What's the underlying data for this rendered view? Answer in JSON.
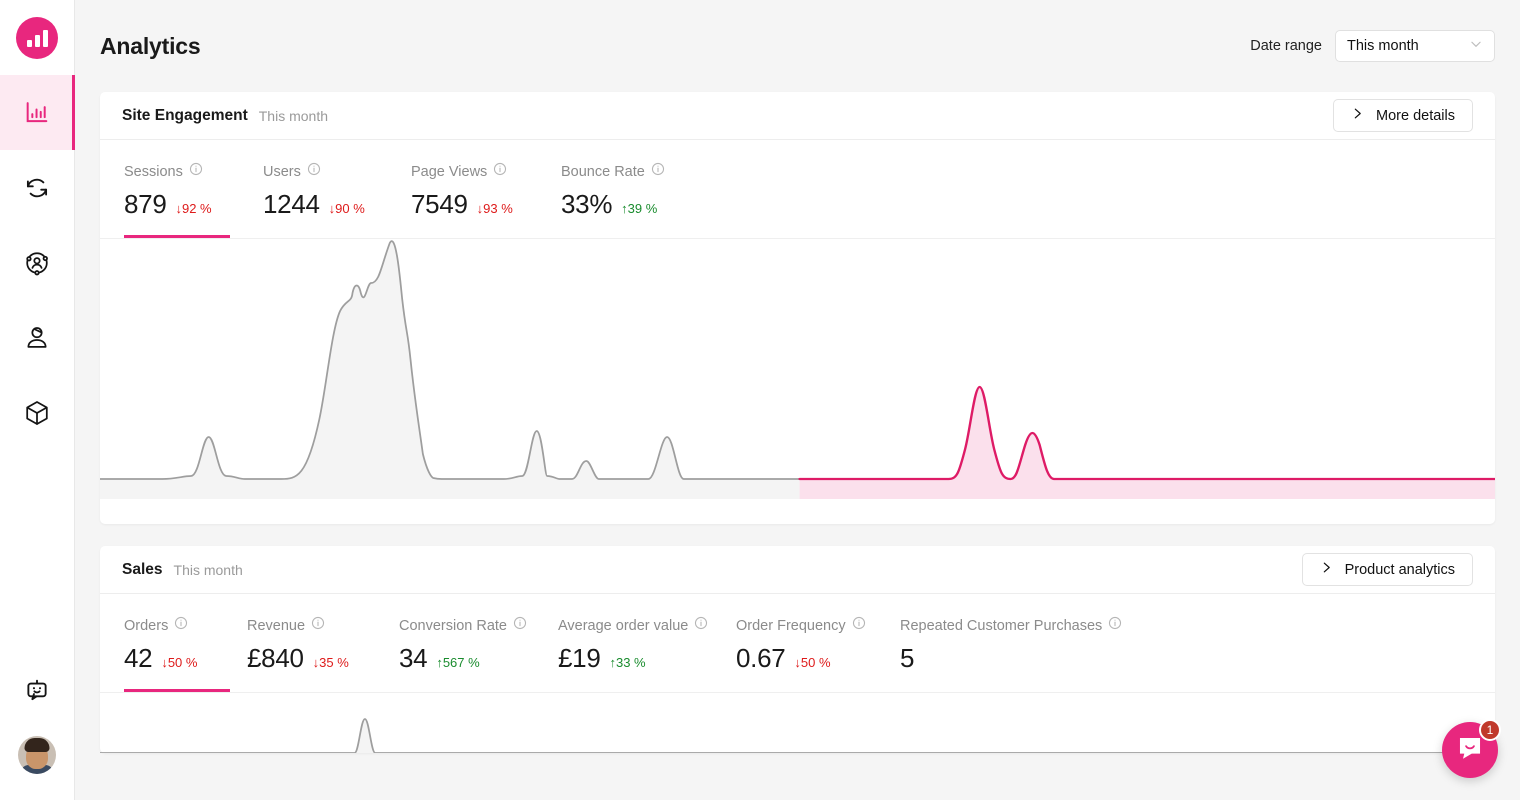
{
  "brand": {
    "accent": "#E8277E",
    "accent_soft": "#FDEAF2",
    "down_color": "#DE1B1B",
    "up_color": "#1A8C2E",
    "logo_icon": "bar-chart-logo"
  },
  "sidebar": {
    "items": [
      {
        "icon": "bar-chart-icon",
        "name": "analytics",
        "active": true
      },
      {
        "icon": "sync-refresh-icon",
        "name": "sync",
        "active": false
      },
      {
        "icon": "user-network-icon",
        "name": "audience",
        "active": false
      },
      {
        "icon": "customer-icon",
        "name": "customers",
        "active": false
      },
      {
        "icon": "cube-package-icon",
        "name": "products",
        "active": false
      }
    ],
    "bottom": [
      {
        "icon": "chat-bot-icon",
        "name": "assistant"
      },
      {
        "icon": "avatar",
        "name": "user-avatar"
      }
    ]
  },
  "header": {
    "title": "Analytics",
    "date_range_label": "Date range",
    "date_range_value": "This month",
    "chevron_icon": "chevron-down-icon"
  },
  "engagement_card": {
    "title": "Site Engagement",
    "subtitle": "This month",
    "action_label": "More details",
    "action_icon": "chevron-right-icon",
    "metrics": [
      {
        "label": "Sessions",
        "value": "879",
        "delta": "↓92 %",
        "dir": "down",
        "active": true,
        "info_icon": "info-icon"
      },
      {
        "label": "Users",
        "value": "1244",
        "delta": "↓90 %",
        "dir": "down",
        "active": false,
        "info_icon": "info-icon"
      },
      {
        "label": "Page Views",
        "value": "7549",
        "delta": "↓93 %",
        "dir": "down",
        "active": false,
        "info_icon": "info-icon"
      },
      {
        "label": "Bounce Rate",
        "value": "33%",
        "delta": "↑39 %",
        "dir": "up",
        "active": false,
        "info_icon": "info-icon"
      }
    ]
  },
  "sales_card": {
    "title": "Sales",
    "subtitle": "This month",
    "action_label": "Product analytics",
    "action_icon": "chevron-right-icon",
    "metrics": [
      {
        "label": "Orders",
        "value": "42",
        "delta": "↓50 %",
        "dir": "down",
        "active": true,
        "info_icon": "info-icon"
      },
      {
        "label": "Revenue",
        "value": "£840",
        "delta": "↓35 %",
        "dir": "down",
        "active": false,
        "info_icon": "info-icon"
      },
      {
        "label": "Conversion Rate",
        "value": "34",
        "delta": "↑567 %",
        "dir": "up",
        "active": false,
        "info_icon": "info-icon"
      },
      {
        "label": "Average order value",
        "value": "£19",
        "delta": "↑33 %",
        "dir": "up",
        "active": false,
        "info_icon": "info-icon"
      },
      {
        "label": "Order Frequency",
        "value": "0.67",
        "delta": "↓50 %",
        "dir": "down",
        "active": false,
        "info_icon": "info-icon"
      },
      {
        "label": "Repeated Customer Purchases",
        "value": "5",
        "delta": "",
        "dir": "",
        "active": false,
        "info_icon": "info-icon"
      }
    ]
  },
  "chat_launcher": {
    "icon": "chat-bubble-icon",
    "badge": "1"
  },
  "chart_data": [
    {
      "id": "engagement-sparkline",
      "type": "area",
      "title": "Site Engagement — Sessions",
      "xlabel": "",
      "ylabel": "",
      "grid": false,
      "legend": "none",
      "xlim": [
        0,
        1348
      ],
      "ylim": [
        0,
        240
      ],
      "series": [
        {
          "name": "Past period",
          "color": "#9e9e9e",
          "fill": "#f4f4f4",
          "x": [
            0,
            60,
            88,
            105,
            122,
            140,
            175,
            205,
            212,
            222,
            232,
            244,
            252,
            262,
            272,
            280,
            292,
            300,
            312,
            322,
            330,
            358,
            390,
            408,
            422,
            432,
            444,
            456,
            470,
            500,
            530,
            560,
            572,
            585,
            600,
            676
          ],
          "y": [
            0,
            0,
            3,
            42,
            3,
            0,
            0,
            2,
            60,
            150,
            168,
            176,
            186,
            196,
            214,
            236,
            224,
            150,
            90,
            30,
            2,
            0,
            0,
            3,
            48,
            3,
            0,
            18,
            0,
            0,
            42,
            3,
            0,
            0,
            0,
            0
          ]
        },
        {
          "name": "Current period",
          "color": "#DE1B66",
          "fill": "#FBE0EC",
          "x": [
            676,
            820,
            832,
            842,
            850,
            860,
            872,
            882,
            890,
            900,
            910,
            1348
          ],
          "y": [
            0,
            0,
            8,
            38,
            54,
            38,
            6,
            4,
            16,
            26,
            4,
            0
          ]
        }
      ],
      "annotations": [
        {
          "type": "period-split",
          "x": 676,
          "note": "gray→pink transition"
        }
      ]
    },
    {
      "id": "sales-sparkline",
      "type": "area",
      "title": "Sales",
      "xlabel": "",
      "ylabel": "",
      "grid": false,
      "legend": "none",
      "series": [
        {
          "name": "Past period",
          "color": "#9e9e9e",
          "fill": "#f4f4f4",
          "x": [
            0,
            240,
            250,
            256,
            262,
            272,
            1348
          ],
          "y": [
            0,
            0,
            14,
            42,
            14,
            0,
            0
          ]
        }
      ]
    }
  ]
}
